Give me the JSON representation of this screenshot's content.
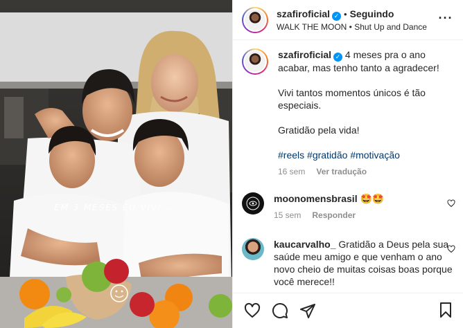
{
  "post": {
    "username": "szafiroficial",
    "follow_status": "Seguindo",
    "music": "WALK THE MOON • Shut Up and Dance",
    "reel_overlay_text": "EM 3 MESES EU VIVI..."
  },
  "caption": {
    "username": "szafiroficial",
    "lines": [
      "4 meses pra o ano acabar, mas tenho tanto a agradecer!",
      "Vivi tantos momentos únicos é tão especiais.",
      "Gratidão pela vida!"
    ],
    "hashtags": [
      "#reels",
      "#gratidão",
      "#motivação"
    ],
    "time": "16 sem",
    "translate_label": "Ver tradução"
  },
  "comments": [
    {
      "username": "moonomensbrasil",
      "text": "🤩🤩",
      "time": "15 sem",
      "reply_label": "Responder"
    },
    {
      "username": "kaucarvalho_",
      "text": "Gratidão a Deus pela sua saúde meu amigo e que venham o ano novo cheio de muitas coisas boas porque você merece!!"
    }
  ],
  "icons": {
    "verified": "verified-badge-icon",
    "more": "more-options-icon",
    "like": "heart-icon",
    "comment": "comment-icon",
    "share": "send-icon",
    "save": "bookmark-icon"
  },
  "colors": {
    "verified_blue": "#0095f6",
    "hashtag": "#00376b",
    "muted": "#8e8e8e",
    "text": "#262626"
  }
}
